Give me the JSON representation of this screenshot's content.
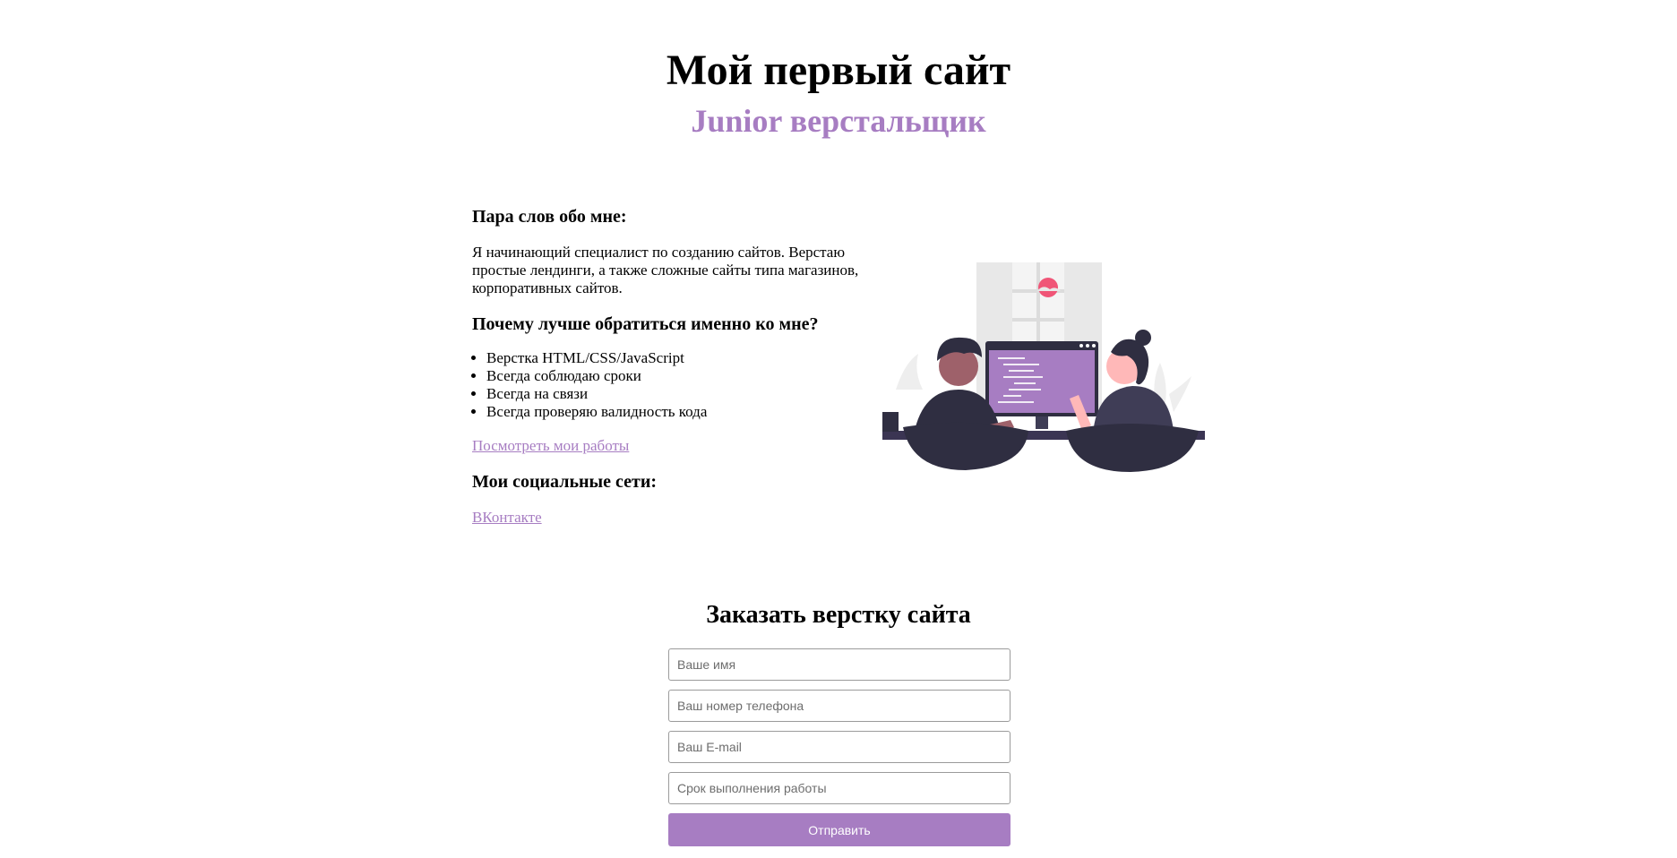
{
  "header": {
    "title": "Мой первый сайт",
    "subtitle": "Junior верстальщик"
  },
  "about": {
    "heading": "Пара слов обо мне:",
    "text": "Я начинающий специалист по созданию сайтов. Верстаю простые лендинги, а также сложные сайты типа магазинов, корпоративных сайтов.",
    "why_heading": "Почему лучше обратиться именно ко мне?",
    "reasons": [
      "Верстка HTML/CSS/JavaScript",
      "Всегда соблюдаю сроки",
      "Всегда на связи",
      "Всегда проверяю валидность кода"
    ],
    "works_link": "Посмотреть мои работы",
    "social_heading": "Мои социальные сети:",
    "social_links": [
      "ВКонтакте"
    ]
  },
  "illustration": {
    "icon": "developers-illustration",
    "accent_color": "#a77dc2"
  },
  "order": {
    "heading": "Заказать верстку сайта",
    "fields": [
      {
        "placeholder": "Ваше имя"
      },
      {
        "placeholder": "Ваш номер телефона"
      },
      {
        "placeholder": "Ваш E-mail"
      },
      {
        "placeholder": "Срок выполнения работы"
      }
    ],
    "submit_label": "Отправить"
  },
  "colors": {
    "accent": "#a77dc2",
    "text": "#000000",
    "background": "#ffffff"
  }
}
